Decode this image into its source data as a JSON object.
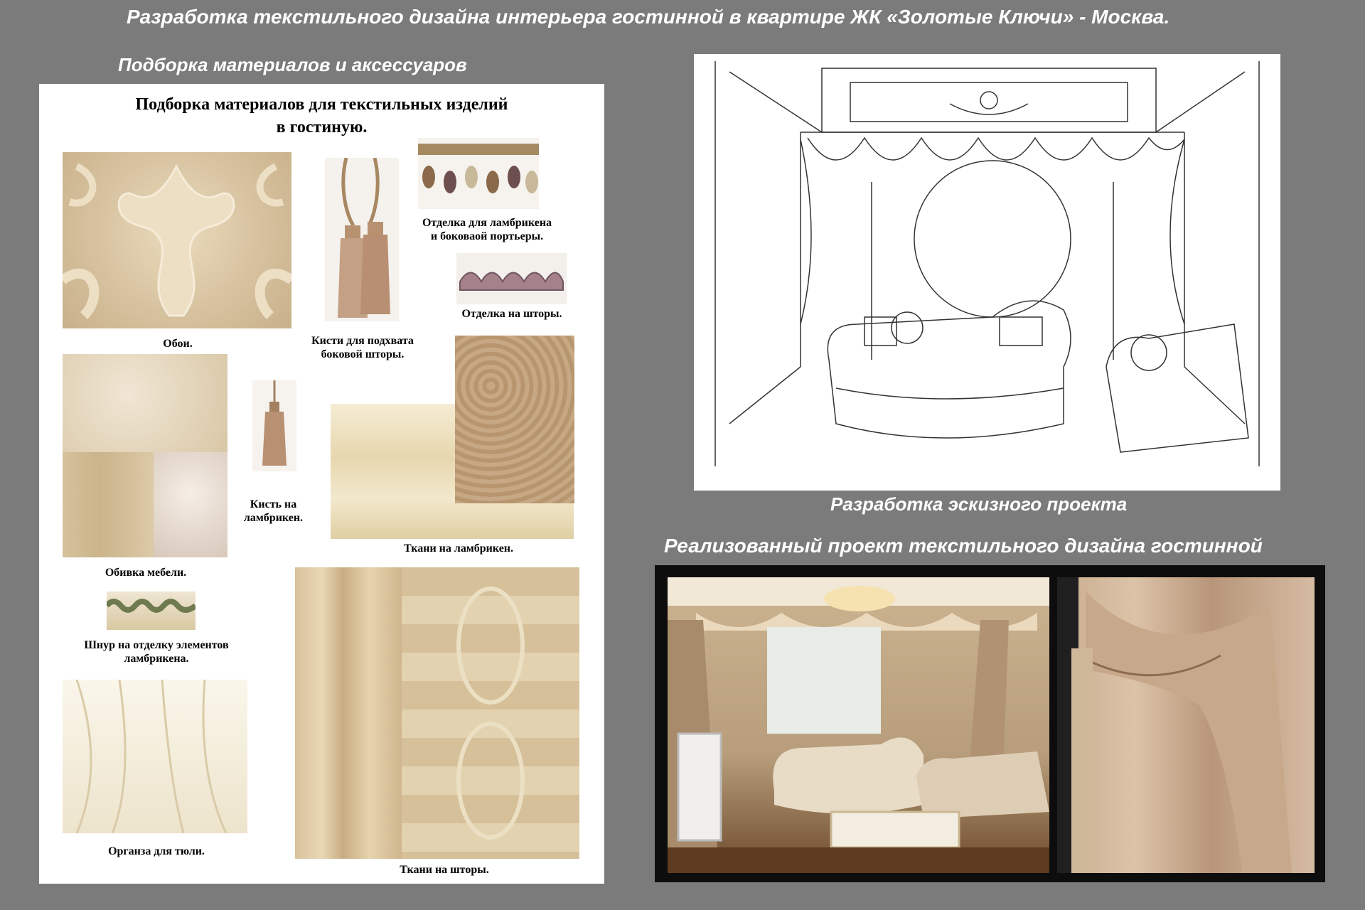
{
  "header": {
    "title": "Разработка текстильного дизайна интерьера гостинной в квартире ЖК «Золотые Ключи» - Москва.",
    "materials_heading": "Подборка материалов и аксессуаров",
    "sketch_caption": "Разработка эскизного проекта",
    "photo_heading": "Реализованный проект текстильного дизайна гостинной"
  },
  "board": {
    "title_line1": "Подборка материалов для текстильных изделий",
    "title_line2": "в гостиную.",
    "captions": {
      "wallpaper": "Обои.",
      "tassels_l1": "Кисти для подхвата",
      "tassels_l2": "боковой шторы.",
      "trim_l1": "Отделка для ламбрикена",
      "trim_l2": "и боковаой портьеры.",
      "curtain_trim": "Отделка на шторы.",
      "upholstery": "Обивка мебели.",
      "small_tassel_l1": "Кисть на",
      "small_tassel_l2": "ламбрикен.",
      "valance_fabrics": "Ткани на ламбрикен.",
      "cord_l1": "Шнур на отделку элементов",
      "cord_l2": "ламбрикена.",
      "organza": "Органза для тюли.",
      "curtain_fabrics": "Ткани на шторы."
    }
  }
}
